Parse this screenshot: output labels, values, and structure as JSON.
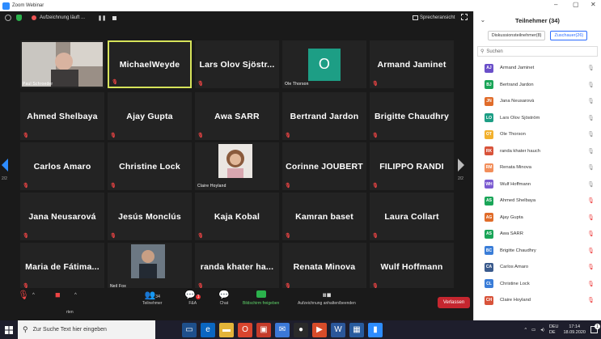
{
  "window": {
    "title": "Zoom Webinar",
    "minimize": "–",
    "maximize": "▢",
    "close": "✕"
  },
  "topbar": {
    "recording_label": "Aufzeichnung läuft ...",
    "speaker_view": "Sprecheransicht"
  },
  "tiles": [
    {
      "name": "Paul Schroeder",
      "kind": "video"
    },
    {
      "name": "MichaelWeyde",
      "kind": "name",
      "selected": true
    },
    {
      "name": "Lars Olov Sjöstr...",
      "kind": "name"
    },
    {
      "name": "Ole Thorson",
      "kind": "avatar",
      "avatar": "O"
    },
    {
      "name": "Armand Jaminet",
      "kind": "name"
    },
    {
      "name": "Ahmed Shelbaya",
      "kind": "name"
    },
    {
      "name": "Ajay Gupta",
      "kind": "name"
    },
    {
      "name": "Awa SARR",
      "kind": "name"
    },
    {
      "name": "Bertrand Jardon",
      "kind": "name"
    },
    {
      "name": "Brigitte Chaudhry",
      "kind": "name"
    },
    {
      "name": "Carlos Amaro",
      "kind": "name"
    },
    {
      "name": "Christine Lock",
      "kind": "name"
    },
    {
      "name": "Claire Hoyland",
      "kind": "photo"
    },
    {
      "name": "Corinne JOUBERT",
      "kind": "name"
    },
    {
      "name": "FILIPPO RANDI",
      "kind": "name"
    },
    {
      "name": "Jana Neusarová",
      "kind": "name"
    },
    {
      "name": "Jesús Monclús",
      "kind": "name"
    },
    {
      "name": "Kaja Kobal",
      "kind": "name"
    },
    {
      "name": "Kamran baset",
      "kind": "name"
    },
    {
      "name": "Laura Collart",
      "kind": "name"
    },
    {
      "name": "Maria de Fátima...",
      "kind": "name"
    },
    {
      "name": "Neil Fox",
      "kind": "photo"
    },
    {
      "name": "randa khater ha...",
      "kind": "name"
    },
    {
      "name": "Renata Minova",
      "kind": "name"
    },
    {
      "name": "Wulf Hoffmann",
      "kind": "name"
    }
  ],
  "pager": {
    "left": "2/2",
    "right": "2/2"
  },
  "controls": {
    "participants_count": "34",
    "participants": "Teilnehmer",
    "qa_badge": "1",
    "qa": "F&A",
    "chat": "Chat",
    "share": "Bildschirm freigeben",
    "record": "Aufzeichnung anhalten/beenden",
    "leave": "Verlassen",
    "partial_label": "rten"
  },
  "panel": {
    "title": "Teilnehmer (34)",
    "tab_panelists": "Diskussionsteilnehmer(8)",
    "tab_attendees": "Zuschauer(26)",
    "search_placeholder": "Suchen",
    "people": [
      {
        "initials": "AJ",
        "name": "Armand Jaminet",
        "color": "#6a4fc9",
        "muted": false
      },
      {
        "initials": "BJ",
        "name": "Bertrand Jardon",
        "color": "#1aa558",
        "muted": false
      },
      {
        "initials": "JN",
        "name": "Jana Neusarová",
        "color": "#e06c2a",
        "muted": false
      },
      {
        "initials": "LO",
        "name": "Lars Olov Sjöström",
        "color": "#1d9e85",
        "muted": false
      },
      {
        "initials": "OT",
        "name": "Ole Thorson",
        "color": "#f2b12e",
        "muted": false
      },
      {
        "initials": "RK",
        "name": "randa khater hauch",
        "color": "#d8533a",
        "muted": false
      },
      {
        "initials": "RM",
        "name": "Renata Minova",
        "color": "#f28e5a",
        "muted": false
      },
      {
        "initials": "WH",
        "name": "Wulf Hoffmann",
        "color": "#7b5bd1",
        "muted": false
      },
      {
        "initials": "AS",
        "name": "Ahmed Shelbaya",
        "color": "#1aa558",
        "muted": true
      },
      {
        "initials": "AG",
        "name": "Ajay Gupta",
        "color": "#e06c2a",
        "muted": true
      },
      {
        "initials": "AS",
        "name": "Awa SARR",
        "color": "#1aa558",
        "muted": true
      },
      {
        "initials": "BC",
        "name": "Brigitte Chaudhry",
        "color": "#3a7dd8",
        "muted": true
      },
      {
        "initials": "CA",
        "name": "Carlos Amaro",
        "color": "#3a5a8c",
        "muted": true
      },
      {
        "initials": "CL",
        "name": "Christine Lock",
        "color": "#3a7dd8",
        "muted": true
      },
      {
        "initials": "CH",
        "name": "Claire Hoyland",
        "color": "#d8533a",
        "muted": true
      }
    ]
  },
  "taskbar": {
    "search_placeholder": "Zur Suche Text hier eingeben",
    "lang1": "DEU",
    "lang2": "DE",
    "time": "17:14",
    "date": "18.09.2020",
    "notif": "1"
  }
}
